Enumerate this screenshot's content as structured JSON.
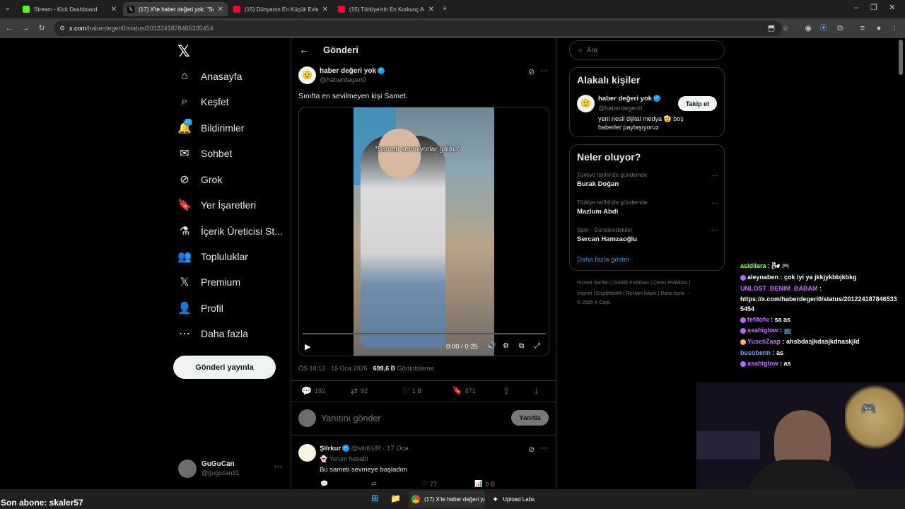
{
  "browser": {
    "tabs": [
      {
        "label": "Stream - Kick Dashboard",
        "color": "#53fc18"
      },
      {
        "label": "(17) X'te haber değeri yok: \"Sın",
        "color": "#ffffff"
      },
      {
        "label": "(15) Dünyanın En Küçük Evleri",
        "color": "#ff0033"
      },
      {
        "label": "(15) Türkiye'nin En Korkunç Aile",
        "color": "#ff0033"
      }
    ],
    "url_host": "x.com",
    "url_path": "/haberdegeri0/status/2012241878465335454"
  },
  "nav": {
    "items": [
      {
        "label": "Anasayfa",
        "icon": "home-icon",
        "glyph": "⌂"
      },
      {
        "label": "Keşfet",
        "icon": "search-icon",
        "glyph": "⌕"
      },
      {
        "label": "Bildirimler",
        "icon": "bell-icon",
        "glyph": "🔔",
        "badge": "17"
      },
      {
        "label": "Sohbet",
        "icon": "mail-icon",
        "glyph": "✉"
      },
      {
        "label": "Grok",
        "icon": "grok-icon",
        "glyph": "⊘"
      },
      {
        "label": "Yer İşaretleri",
        "icon": "bookmark-icon",
        "glyph": "🔖"
      },
      {
        "label": "İçerik Üreticisi St...",
        "icon": "flask-icon",
        "glyph": "⚗"
      },
      {
        "label": "Topluluklar",
        "icon": "people-icon",
        "glyph": "👥"
      },
      {
        "label": "Premium",
        "icon": "x-icon",
        "glyph": "𝕏"
      },
      {
        "label": "Profil",
        "icon": "person-icon",
        "glyph": "👤"
      },
      {
        "label": "Daha fazla",
        "icon": "more-circle-icon",
        "glyph": "⋯"
      }
    ],
    "post_button": "Gönderi yayınla",
    "account_name": "GuGuCan",
    "account_handle": "@gugucan31"
  },
  "main": {
    "title": "Gönderi",
    "author_name": "haber değeri yok",
    "author_handle": "@haberdegeri0",
    "text": "Sınıfta en sevilmeyen kişi Samet.",
    "video_caption": "\"Sameti sevmiyorlar galiba\"",
    "video_time": "0:00 / 0:25",
    "video_progress": 0,
    "meta_time": "ÖS 10:13 · 16 Oca 2026 · ",
    "meta_views": "699,6 B",
    "meta_views_label": " Görüntüleme",
    "stats": {
      "replies": "192",
      "reposts": "92",
      "likes": "1 B",
      "bookmarks": "871"
    },
    "reply_placeholder": "Yanıtını gönder",
    "reply_button": "Yanıtla",
    "reply": {
      "name": "Şilrkur",
      "handle": "@silrKUR · 17 Oca",
      "label": "Yorum hesabı",
      "text": "Bu sameti sevmeye başladım",
      "likes": "77",
      "views": "9 B"
    }
  },
  "right": {
    "search_placeholder": "Ara",
    "related_title": "Alakalı kişiler",
    "related_name": "haber değeri yok",
    "related_handle": "@haberdegeri0",
    "related_bio": "yeni nesil dijital medya 🫡 boş haberler paylaşıyoruz",
    "follow_button": "Takip et",
    "trends_title": "Neler oluyor?",
    "trends": [
      {
        "category": "Türkiye tarihinde gündemde",
        "name": "Burak Doğan"
      },
      {
        "category": "Türkiye tarihinde gündemde",
        "name": "Mazlum Abdi"
      },
      {
        "category": "Spor · Gündemdekiler",
        "name": "Sercan Hamzaoğlu"
      }
    ],
    "show_more": "Daha fazla göster",
    "footer_line1": "Hizmet Şartları  |  Gizlilik Politikası  |  Çerez Politikası  |",
    "footer_line2": "İmprint  |  Erişilebilirlik  |  Reklam bilgisi  |  Daha fazla ···",
    "footer_line3": "© 2026 X Corp."
  },
  "chat": [
    {
      "user": "asidilara",
      "color": "#9bff6b",
      "msg": " : 🌬 🎮"
    },
    {
      "user": "aleynaben",
      "color": "#ffffff",
      "msg": " : çok iyi ya jkkjykbbjkbkg",
      "emo": "#b06bff"
    },
    {
      "user": "UNLOST_BENIM_BABAM",
      "color": "#c56bff",
      "msg": " :"
    },
    {
      "user": "",
      "color": "#ffffff",
      "msg": "https://x.com/haberdegeri0/status/201224187846533"
    },
    {
      "user": "",
      "color": "#ffffff",
      "msg": "5454"
    },
    {
      "user": "fefifofu",
      "color": "#c56bff",
      "msg": " : sa as",
      "emo": "#b06bff"
    },
    {
      "user": "asahiglow",
      "color": "#c56bff",
      "msg": " : 📺",
      "emo": "#b06bff"
    },
    {
      "user": "YuseiiZaap",
      "color": "#c56bff",
      "msg": " : ahsbdasjkdasjkdnaskjld",
      "emo": "#ffb34d"
    },
    {
      "user": "busobenn",
      "color": "#6ba4ff",
      "msg": " : as"
    },
    {
      "user": "asahiglow",
      "color": "#c56bff",
      "msg": " : as",
      "emo": "#b06bff"
    }
  ],
  "overlay": {
    "subscriber": "Son abone: skaler57"
  },
  "taskbar": {
    "chrome_label": "(17) X'te haber değeri yo",
    "upload_label": "Upload Labs"
  },
  "colors": {
    "accent": "#1d9bf0",
    "kick": "#53fc18",
    "youtube": "#ff0033"
  }
}
